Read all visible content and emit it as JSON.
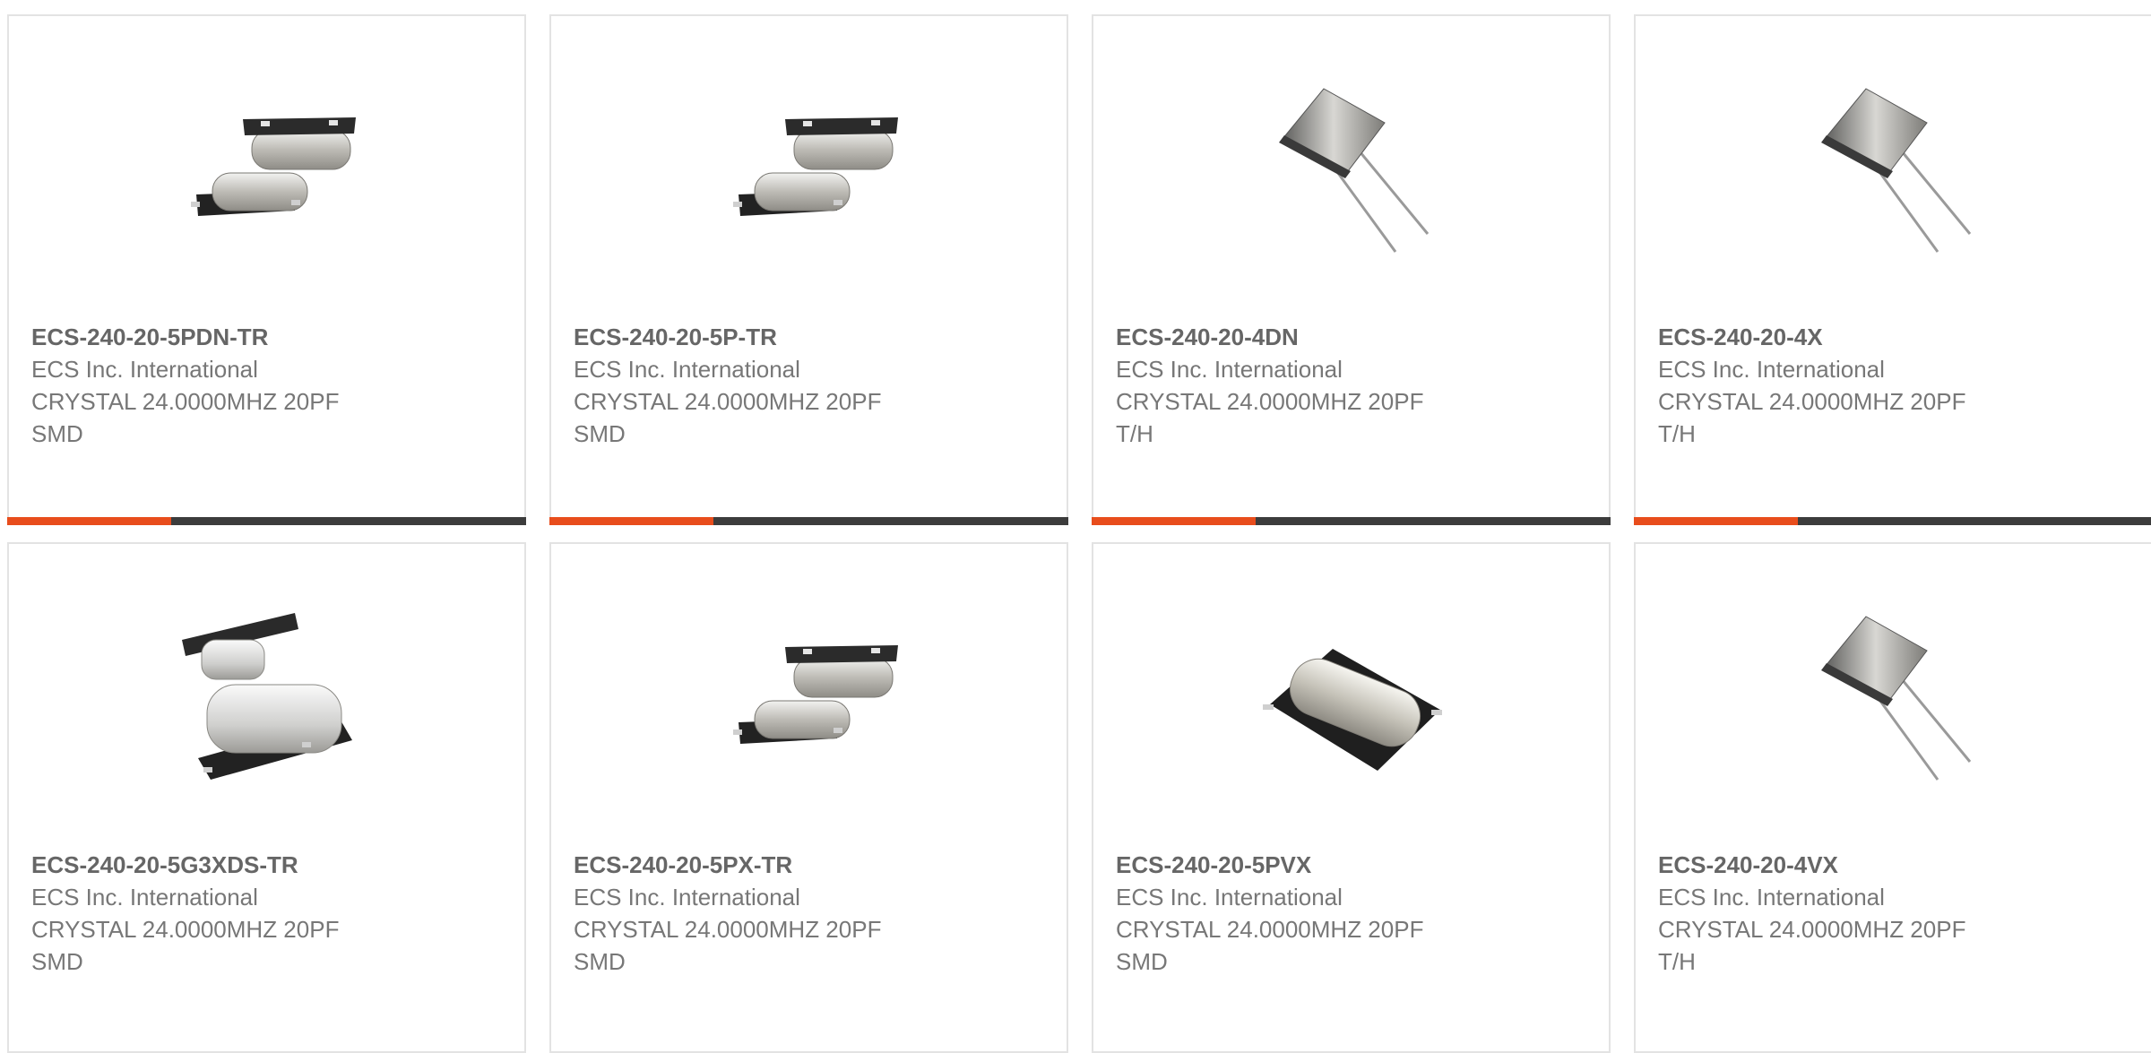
{
  "colors": {
    "accent": "#e84d1c",
    "bar": "#3c3c3c",
    "border": "#e3e3e3",
    "text_bold": "#666666",
    "text": "#777777"
  },
  "products": [
    {
      "part_number": "ECS-240-20-5PDN-TR",
      "manufacturer": "ECS Inc. International",
      "description": "CRYSTAL 24.0000MHZ 20PF",
      "mount": "SMD",
      "image_icon": "smd-crystal-pair-icon",
      "show_bar": true
    },
    {
      "part_number": "ECS-240-20-5P-TR",
      "manufacturer": "ECS Inc. International",
      "description": "CRYSTAL 24.0000MHZ 20PF",
      "mount": "SMD",
      "image_icon": "smd-crystal-pair-icon",
      "show_bar": true
    },
    {
      "part_number": "ECS-240-20-4DN",
      "manufacturer": "ECS Inc. International",
      "description": "CRYSTAL 24.0000MHZ 20PF",
      "mount": "T/H",
      "image_icon": "through-hole-crystal-icon",
      "show_bar": true
    },
    {
      "part_number": "ECS-240-20-4X",
      "manufacturer": "ECS Inc. International",
      "description": "CRYSTAL 24.0000MHZ 20PF",
      "mount": "T/H",
      "image_icon": "through-hole-crystal-icon",
      "show_bar": true
    },
    {
      "part_number": "ECS-240-20-5G3XDS-TR",
      "manufacturer": "ECS Inc. International",
      "description": "CRYSTAL 24.0000MHZ 20PF",
      "mount": "SMD",
      "image_icon": "smd-crystal-large-pair-icon",
      "show_bar": false
    },
    {
      "part_number": "ECS-240-20-5PX-TR",
      "manufacturer": "ECS Inc. International",
      "description": "CRYSTAL 24.0000MHZ 20PF",
      "mount": "SMD",
      "image_icon": "smd-crystal-pair-icon",
      "show_bar": false
    },
    {
      "part_number": "ECS-240-20-5PVX",
      "manufacturer": "ECS Inc. International",
      "description": "CRYSTAL 24.0000MHZ 20PF",
      "mount": "SMD",
      "image_icon": "smd-crystal-single-icon",
      "show_bar": false
    },
    {
      "part_number": "ECS-240-20-4VX",
      "manufacturer": "ECS Inc. International",
      "description": "CRYSTAL 24.0000MHZ 20PF",
      "mount": "T/H",
      "image_icon": "through-hole-crystal-icon",
      "show_bar": false
    }
  ]
}
